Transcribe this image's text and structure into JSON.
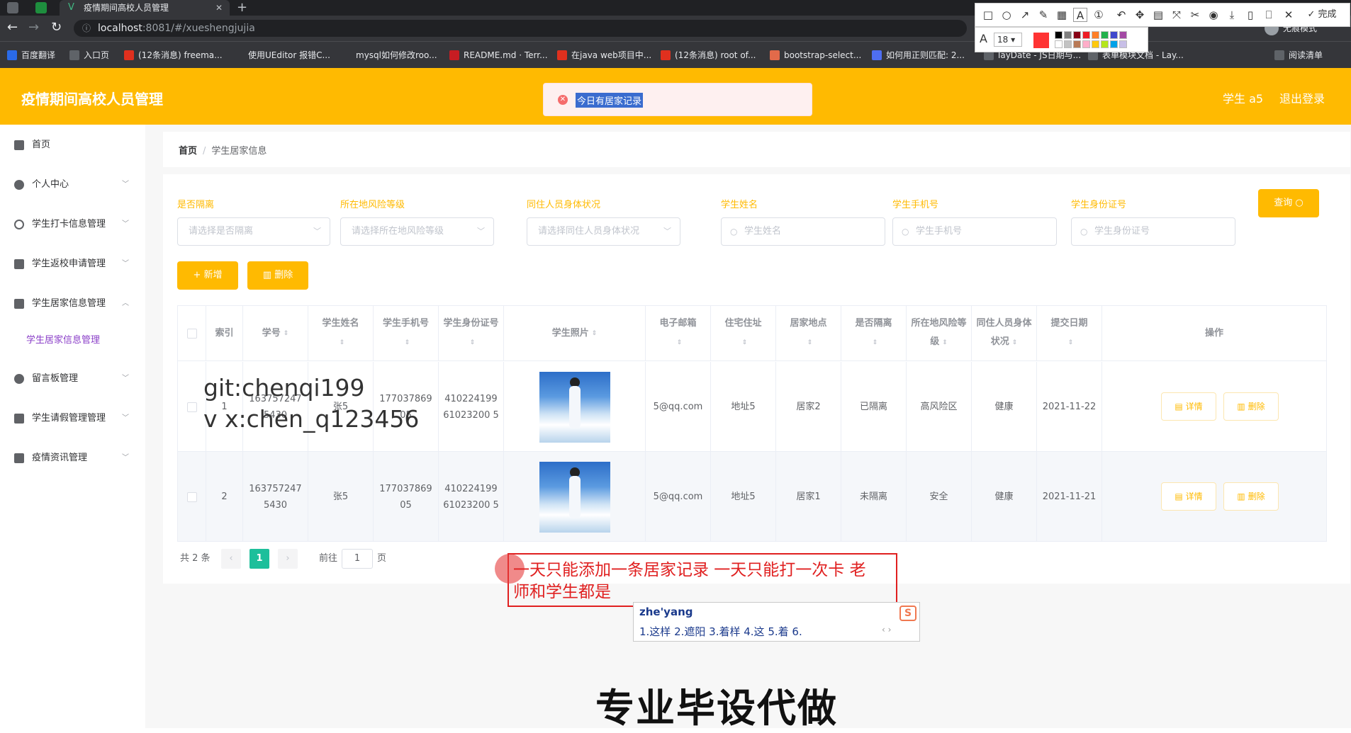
{
  "browser": {
    "tab_title": "疫情期间高校人员管理",
    "url_host": "localhost",
    "url_path": ":8081/#/xueshengjujia",
    "profile_label": "无痕模式",
    "bookmarks": [
      "百度翻译",
      "入口页",
      "(12条消息) freema...",
      "使用UEditor 报错C...",
      "mysql如何修改roo...",
      "README.md · Terr...",
      "在java web项目中...",
      "(12条消息) root of...",
      "bootstrap-select...",
      "如何用正则匹配: 2...",
      "layDate - JS日期与...",
      "表单模块文档 - Lay...",
      "阅读清单"
    ]
  },
  "screenshot_tool": {
    "font_size": "18",
    "done_label": "完成",
    "accent": "#ff3333",
    "palette": [
      "#000000",
      "#7f7f7f",
      "#880015",
      "#ed1c24",
      "#ff7f27",
      "#22b14c",
      "#3f48cc",
      "#a349a4",
      "#ffffff",
      "#c3c3c3",
      "#b97a57",
      "#ffaec9",
      "#ffc90e",
      "#b5e61d",
      "#00a2e8",
      "#c8bfe7"
    ]
  },
  "header": {
    "title": "疫情期间高校人员管理",
    "user": "学生 a5",
    "logout": "退出登录",
    "color": "#ffba01"
  },
  "toast": {
    "message": "今日有居家记录"
  },
  "sidebar": {
    "items": [
      {
        "label": "首页",
        "icon": "home-icon"
      },
      {
        "label": "个人中心",
        "icon": "user-icon"
      },
      {
        "label": "学生打卡信息管理",
        "icon": "clock-icon"
      },
      {
        "label": "学生返校申请管理",
        "icon": "briefcase-icon"
      },
      {
        "label": "学生居家信息管理",
        "icon": "chart-icon"
      },
      {
        "label": "留言板管理",
        "icon": "chat-icon"
      },
      {
        "label": "学生请假管理管理",
        "icon": "checklist-icon"
      },
      {
        "label": "疫情资讯管理",
        "icon": "news-icon"
      }
    ],
    "sub_active": "学生居家信息管理"
  },
  "breadcrumb": {
    "home": "首页",
    "current": "学生居家信息"
  },
  "filters": [
    {
      "label": "是否隔离",
      "placeholder": "请选择是否隔离",
      "kind": "select"
    },
    {
      "label": "所在地风险等级",
      "placeholder": "请选择所在地风险等级",
      "kind": "select"
    },
    {
      "label": "同住人员身体状况",
      "placeholder": "请选择同住人员身体状况",
      "kind": "select"
    },
    {
      "label": "学生姓名",
      "placeholder": "学生姓名",
      "kind": "input"
    },
    {
      "label": "学生手机号",
      "placeholder": "学生手机号",
      "kind": "input"
    },
    {
      "label": "学生身份证号",
      "placeholder": "学生身份证号",
      "kind": "input"
    }
  ],
  "buttons": {
    "query": "查询",
    "add": "新增",
    "delete": "删除"
  },
  "table": {
    "headers": [
      "索引",
      "学号",
      "学生姓名",
      "学生手机号",
      "学生身份证号",
      "学生照片",
      "电子邮箱",
      "住宅住址",
      "居家地点",
      "是否隔离",
      "所在地风险等级",
      "同住人员身体状况",
      "提交日期",
      "操作"
    ],
    "rows": [
      {
        "index": "1",
        "xuehao": "1637572475430",
        "name": "张5",
        "phone": "17703786905",
        "idcard": "41022419961023200 5",
        "email": "5@qq.com",
        "address": "地址5",
        "place": "居家2",
        "isolated": "已隔离",
        "risk": "高风险区",
        "health": "健康",
        "date": "2021-11-22"
      },
      {
        "index": "2",
        "xuehao": "1637572475430",
        "name": "张5",
        "phone": "17703786905",
        "idcard": "41022419961023200 5",
        "email": "5@qq.com",
        "address": "地址5",
        "place": "居家1",
        "isolated": "未隔离",
        "risk": "安全",
        "health": "健康",
        "date": "2021-11-21"
      }
    ],
    "detail_label": "详情",
    "delete_label": "删除"
  },
  "pagination": {
    "total": "共 2 条",
    "current": "1",
    "goto_label": "前往",
    "goto_value": "1",
    "page_suffix": "页"
  },
  "watermark": {
    "line1": "git:chenqi199",
    "line2": "v x:chen_q123456",
    "bottom": "专业毕设代做"
  },
  "annotation": {
    "text": "一天只能添加一条居家记录 一天只能打一次卡 老师和学生都是"
  },
  "ime": {
    "pinyin": "zhe'yang",
    "candidates": "1.这样  2.遮阳  3.着样  4.这  5.着  6."
  }
}
